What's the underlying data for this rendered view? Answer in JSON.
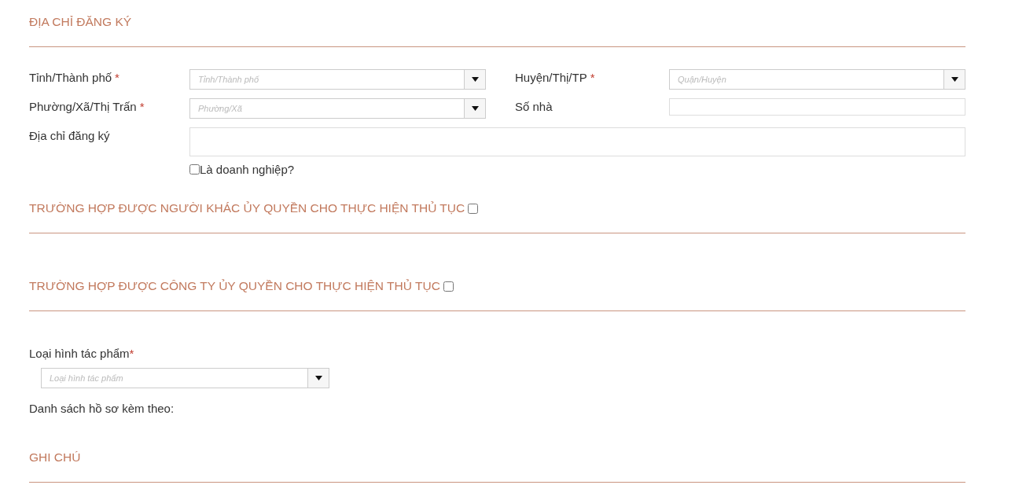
{
  "address_section": {
    "title": "ĐỊA CHỈ ĐĂNG KÝ",
    "fields": [
      {
        "kind": "select",
        "label": "Tỉnh/Thành phố",
        "required_mark": "*",
        "placeholder": "Tỉnh/Thành phố"
      },
      {
        "kind": "select",
        "label": "Huyện/Thị/TP",
        "required_mark": "*",
        "placeholder": "Quận/Huyện"
      },
      {
        "kind": "select",
        "label": "Phường/Xã/Thị Trấn",
        "required_mark": "*",
        "placeholder": "Phường/Xã"
      },
      {
        "kind": "text",
        "label": "Số nhà"
      }
    ],
    "address": {
      "label": "Địa chỉ đăng ký"
    },
    "business_checkbox": {
      "label": "Là doanh nghiệp?",
      "checked": false
    }
  },
  "authorization_sections": [
    {
      "title": "TRƯỜNG HỢP ĐƯỢC NGƯỜI KHÁC ỦY QUYỀN CHO THỰC HIỆN THỦ TỤC",
      "checked": false
    },
    {
      "title": "TRƯỜNG HỢP ĐƯỢC CÔNG TY ỦY QUYỀN CHO THỰC HIỆN THỦ TỤC",
      "checked": false
    }
  ],
  "work_type": {
    "label": "Loại hình tác phẩm",
    "required_mark": "*",
    "placeholder": "Loại hình tác phẩm"
  },
  "attachments_label": "Danh sách hồ sơ kèm theo:",
  "notes_section": {
    "title": "GHI CHÚ"
  }
}
